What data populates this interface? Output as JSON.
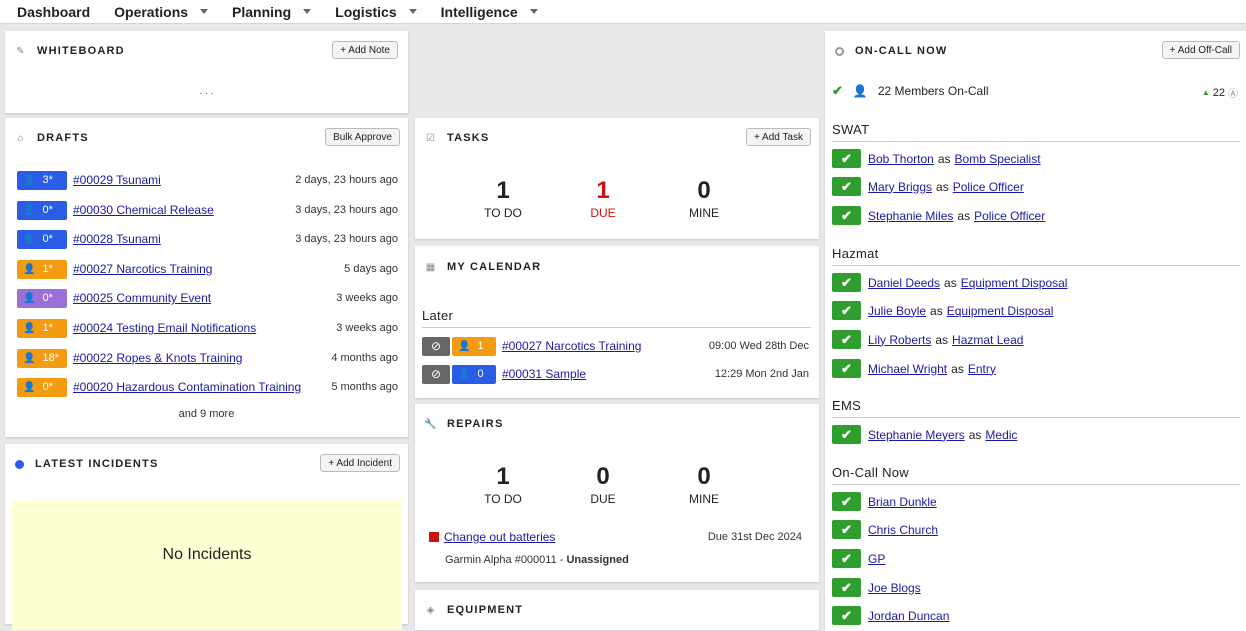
{
  "nav": {
    "items": [
      "Dashboard",
      "Operations",
      "Planning",
      "Logistics",
      "Intelligence"
    ]
  },
  "whiteboard": {
    "title": "WHITEBOARD",
    "add_note": "+ Add Note",
    "content": ". . ."
  },
  "drafts": {
    "title": "DRAFTS",
    "bulk": "Bulk Approve",
    "more": "and 9 more",
    "rows": [
      {
        "count": "3*",
        "color": "#2a5ce6",
        "link": "#00029 Tsunami",
        "age": "2 days, 23 hours ago"
      },
      {
        "count": "0*",
        "color": "#2a5ce6",
        "link": "#00030 Chemical Release",
        "age": "3 days, 23 hours ago"
      },
      {
        "count": "0*",
        "color": "#2a5ce6",
        "link": "#00028 Tsunami",
        "age": "3 days, 23 hours ago"
      },
      {
        "count": "1*",
        "color": "#f39c12",
        "link": "#00027 Narcotics Training",
        "age": "5 days ago"
      },
      {
        "count": "0*",
        "color": "#9b6fd8",
        "link": "#00025 Community Event",
        "age": "3 weeks ago"
      },
      {
        "count": "1*",
        "color": "#f39c12",
        "link": "#00024 Testing Email Notifications",
        "age": "3 weeks ago"
      },
      {
        "count": "18*",
        "color": "#f39c12",
        "link": "#00022 Ropes & Knots Training",
        "age": "4 months ago"
      },
      {
        "count": "0*",
        "color": "#f39c12",
        "link": "#00020 Hazardous Contamination Training",
        "age": "5 months ago"
      }
    ]
  },
  "incidents": {
    "title": "LATEST INCIDENTS",
    "add": "+ Add Incident",
    "empty": "No Incidents"
  },
  "tasks": {
    "title": "TASKS",
    "add": "+ Add Task",
    "todo": "1",
    "todo_label": "TO DO",
    "due": "1",
    "due_label": "DUE",
    "mine": "0",
    "mine_label": "MINE"
  },
  "calendar": {
    "title": "MY CALENDAR",
    "section": "Later",
    "rows": [
      {
        "count": "1",
        "color": "#f39c12",
        "link": "#00027 Narcotics Training",
        "when": "09:00 Wed 28th Dec"
      },
      {
        "count": "0",
        "color": "#2a5ce6",
        "link": "#00031 Sample",
        "when": "12:29 Mon 2nd Jan"
      }
    ]
  },
  "repairs": {
    "title": "REPAIRS",
    "todo": "1",
    "todo_label": "TO DO",
    "due": "0",
    "due_label": "DUE",
    "mine": "0",
    "mine_label": "MINE",
    "item": "Change out batteries",
    "item_due": "Due 31st Dec 2024",
    "sub": "Garmin Alpha #000011 - ",
    "sub_bold": "Unassigned"
  },
  "equipment": {
    "title": "EQUIPMENT"
  },
  "oncall": {
    "title": "ON-CALL NOW",
    "add": "+ Add Off-Call",
    "members": "22 Members On-Call",
    "count": "22",
    "as": "as",
    "swat_label": "SWAT",
    "swat": [
      {
        "name": "Bob Thorton",
        "role": "Bomb Specialist"
      },
      {
        "name": "Mary Briggs",
        "role": "Police Officer"
      },
      {
        "name": "Stephanie Miles",
        "role": "Police Officer"
      }
    ],
    "hazmat_label": "Hazmat",
    "hazmat": [
      {
        "name": "Daniel Deeds",
        "role": "Equipment Disposal"
      },
      {
        "name": "Julie Boyle",
        "role": "Equipment Disposal"
      },
      {
        "name": "Lily Roberts",
        "role": "Hazmat Lead"
      },
      {
        "name": "Michael Wright",
        "role": "Entry"
      }
    ],
    "ems_label": "EMS",
    "ems": [
      {
        "name": "Stephanie Meyers",
        "role": "Medic"
      }
    ],
    "now_label": "On-Call Now",
    "now": [
      "Brian Dunkle",
      "Chris Church",
      "GP",
      "Joe Blogs",
      "Jordan Duncan"
    ]
  },
  "colors": {
    "accent": "#2a5ce6",
    "due_red": "#cc1111",
    "check_green": "#2f9e2f",
    "incident_bg": "#ffffd4"
  }
}
